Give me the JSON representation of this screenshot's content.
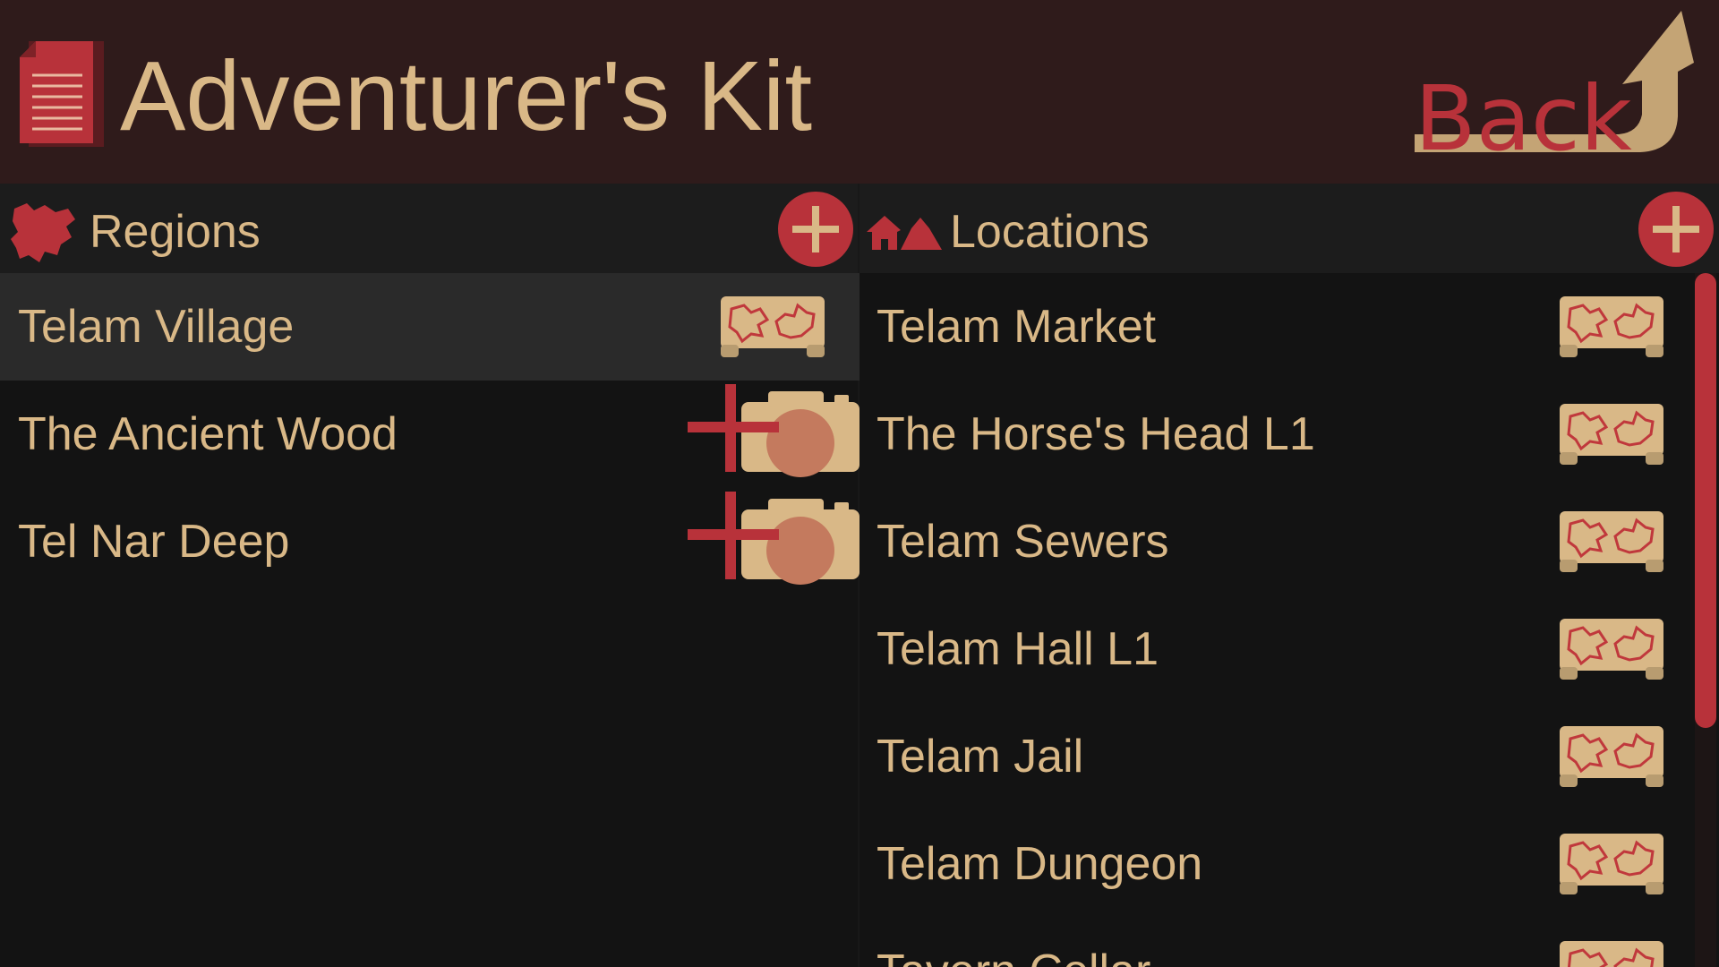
{
  "app": {
    "title": "Adventurer's Kit",
    "back_label": "Back"
  },
  "colors": {
    "header_bg": "#2f1b1b",
    "body_bg": "#131313",
    "accent_red": "#b8323a",
    "tan": "#d9b887"
  },
  "regions": {
    "title": "Regions",
    "icon": "region-map-icon",
    "items": [
      {
        "label": "Telam Village",
        "action_icon": "map-icon",
        "selected": true
      },
      {
        "label": "The Ancient Wood",
        "action_icon": "add-photo-icon",
        "selected": false
      },
      {
        "label": "Tel Nar Deep",
        "action_icon": "add-photo-icon",
        "selected": false
      }
    ]
  },
  "locations": {
    "title": "Locations",
    "icon": "houses-icon",
    "items": [
      {
        "label": "Telam Market",
        "action_icon": "map-icon"
      },
      {
        "label": "The Horse's Head L1",
        "action_icon": "map-icon"
      },
      {
        "label": "Telam Sewers",
        "action_icon": "map-icon"
      },
      {
        "label": "Telam Hall L1",
        "action_icon": "map-icon"
      },
      {
        "label": "Telam Jail",
        "action_icon": "map-icon"
      },
      {
        "label": "Telam Dungeon",
        "action_icon": "map-icon"
      },
      {
        "label": "Tavern Cellar",
        "action_icon": "map-icon"
      }
    ]
  }
}
